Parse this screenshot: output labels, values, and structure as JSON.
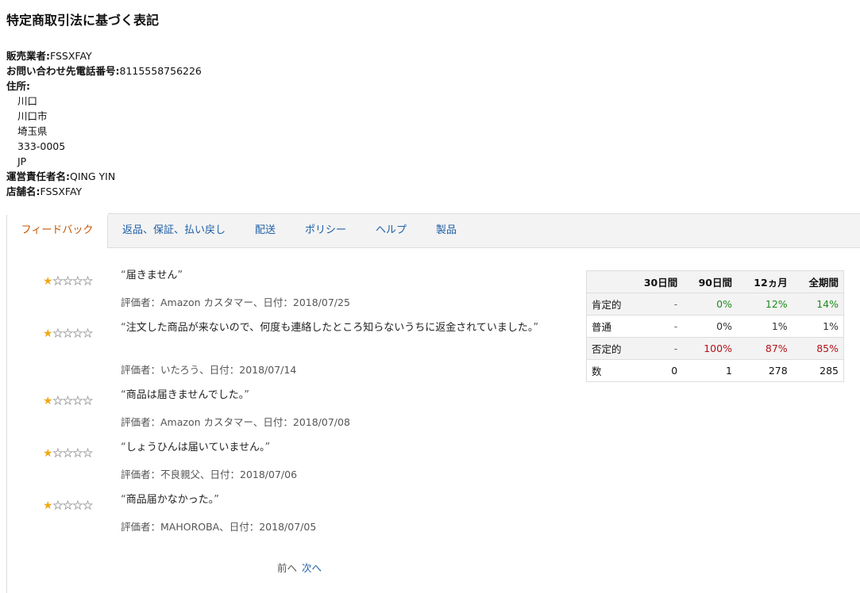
{
  "page_title": "特定商取引法に基づく表記",
  "seller": {
    "business_label": "販売業者:",
    "business_value": "FSSXFAY",
    "phone_label": "お問い合わせ先電話番号:",
    "phone_value": "8115558756226",
    "address_label": "住所:",
    "address_lines": [
      "川口",
      "川口市",
      "埼玉県",
      "333-0005",
      "JP"
    ],
    "manager_label": "運営責任者名:",
    "manager_value": "QING YIN",
    "store_label": "店舗名:",
    "store_value": "FSSXFAY"
  },
  "tabs": [
    {
      "label": "フィードバック",
      "active": true
    },
    {
      "label": "返品、保証、払い戻し",
      "active": false
    },
    {
      "label": "配送",
      "active": false
    },
    {
      "label": "ポリシー",
      "active": false
    },
    {
      "label": "ヘルプ",
      "active": false
    },
    {
      "label": "製品",
      "active": false
    }
  ],
  "reviews": [
    {
      "rating": 1,
      "text": "届きません",
      "rater": "評価者：Amazon カスタマー、日付：2018/07/25"
    },
    {
      "rating": 1,
      "text": "注文した商品が来ないので、何度も連絡したところ知らないうちに返金されていました。",
      "rater": "評価者：いたろう、日付：2018/07/14"
    },
    {
      "rating": 1,
      "text": "商品は届きませんでした。",
      "rater": "評価者：Amazon カスタマー、日付：2018/07/08"
    },
    {
      "rating": 1,
      "text": "しょうひんは届いていません。",
      "rater": "評価者：不良親父、日付：2018/07/06"
    },
    {
      "rating": 1,
      "text": "商品届かなかった。",
      "rater": "評価者：MAHOROBA、日付：2018/07/05"
    }
  ],
  "pager": {
    "prev": "前へ",
    "next": "次へ"
  },
  "stats": {
    "headers": [
      "",
      "30日間",
      "90日間",
      "12ヵ月",
      "全期間"
    ],
    "rows": [
      {
        "label": "肯定的",
        "cells": [
          "-",
          "0%",
          "12%",
          "14%"
        ]
      },
      {
        "label": "普通",
        "cells": [
          "-",
          "0%",
          "1%",
          "1%"
        ]
      },
      {
        "label": "否定的",
        "cells": [
          "-",
          "100%",
          "87%",
          "85%"
        ]
      },
      {
        "label": "数",
        "cells": [
          "0",
          "1",
          "278",
          "285"
        ]
      }
    ]
  },
  "colors": {
    "link": "#1f5fa6",
    "active_tab": "#c45500",
    "star": "#f0a818",
    "positive": "#1f8a1f",
    "negative": "#b3121b"
  }
}
